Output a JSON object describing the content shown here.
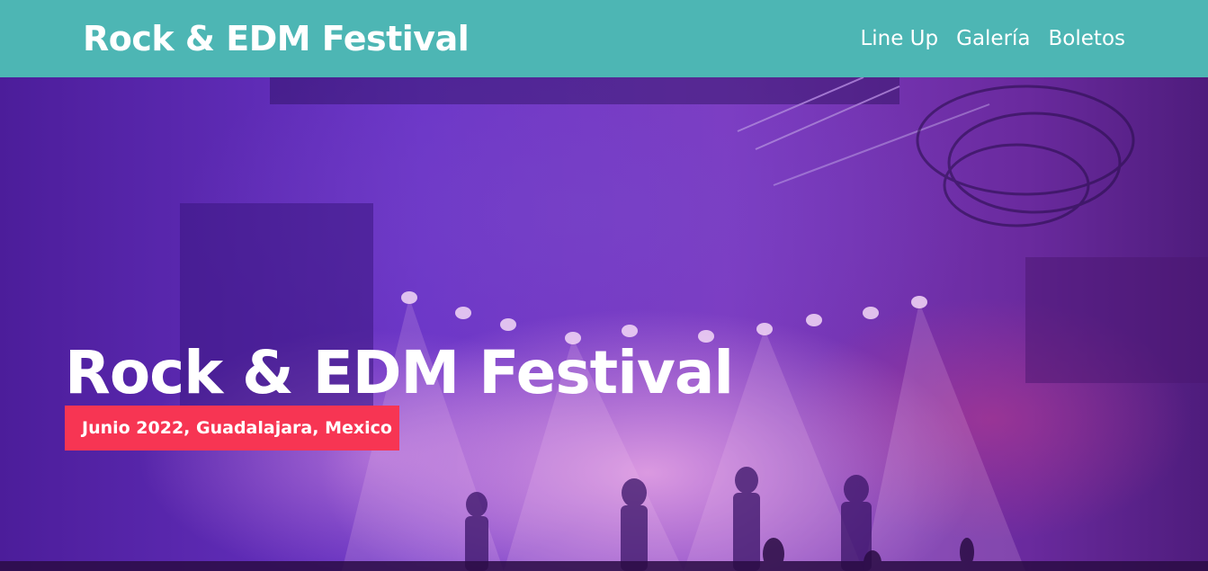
{
  "header": {
    "brand": "Rock & EDM Festival",
    "background_color": "#4db6b4",
    "nav": [
      {
        "label": "Line Up"
      },
      {
        "label": "Galería"
      },
      {
        "label": "Boletos"
      }
    ]
  },
  "hero": {
    "title": "Rock & EDM Festival",
    "subtitle": "Junio 2022, Guadalajara, Mexico",
    "badge_color": "#f73553",
    "background_image": "concert-stage-photo"
  }
}
